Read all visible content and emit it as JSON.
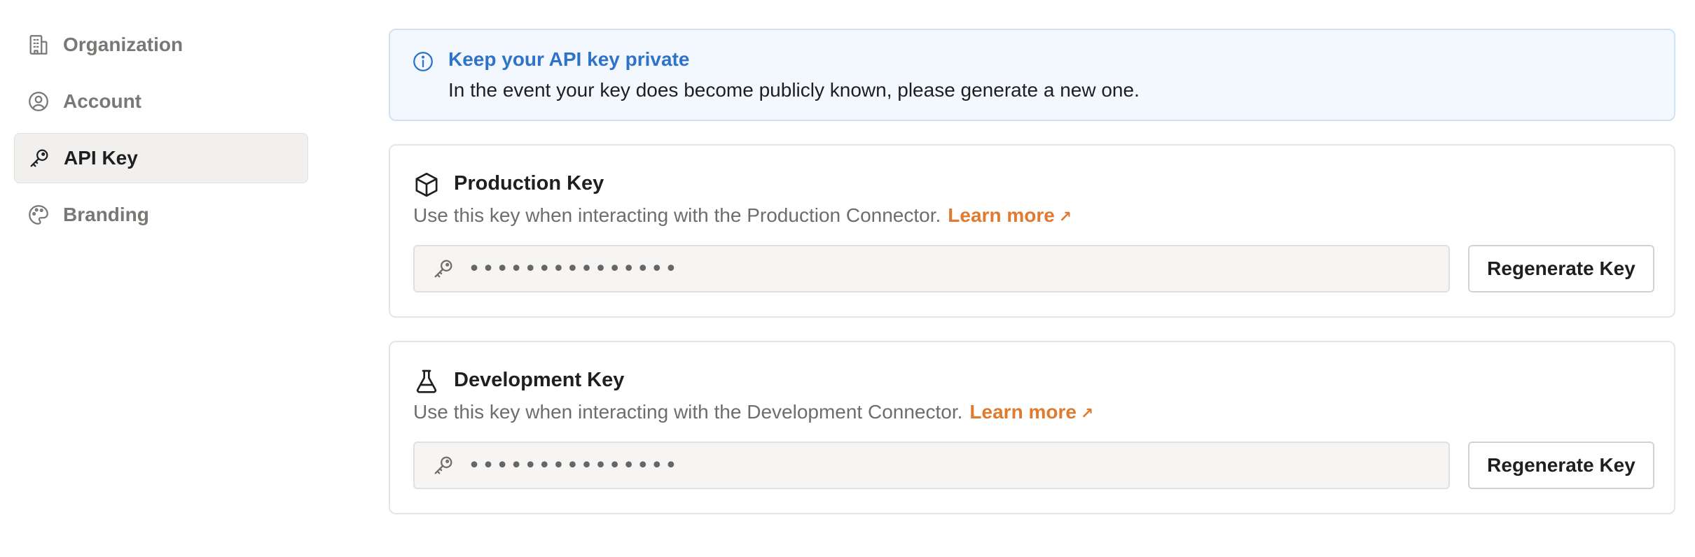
{
  "sidebar": {
    "items": [
      {
        "label": "Organization",
        "icon": "building-icon",
        "active": false
      },
      {
        "label": "Account",
        "icon": "user-circle-icon",
        "active": false
      },
      {
        "label": "API Key",
        "icon": "key-icon",
        "active": true
      },
      {
        "label": "Branding",
        "icon": "palette-icon",
        "active": false
      }
    ]
  },
  "alert": {
    "icon": "info-icon",
    "title": "Keep your API key private",
    "body": "In the event your key does become publicly known, please generate a new one."
  },
  "production": {
    "icon": "cube-icon",
    "title": "Production Key",
    "description": "Use this key when interacting with the Production Connector.",
    "learn_more": "Learn more",
    "key_mask": "•••••••••••••••",
    "regenerate_label": "Regenerate Key"
  },
  "development": {
    "icon": "flask-icon",
    "title": "Development Key",
    "description": "Use this key when interacting with the Development Connector.",
    "learn_more": "Learn more",
    "key_mask": "•••••••••••••••",
    "regenerate_label": "Regenerate Key"
  },
  "colors": {
    "accent_blue": "#2f73c9",
    "link_orange": "#e07a2f",
    "muted_text": "#6f6d6a"
  }
}
